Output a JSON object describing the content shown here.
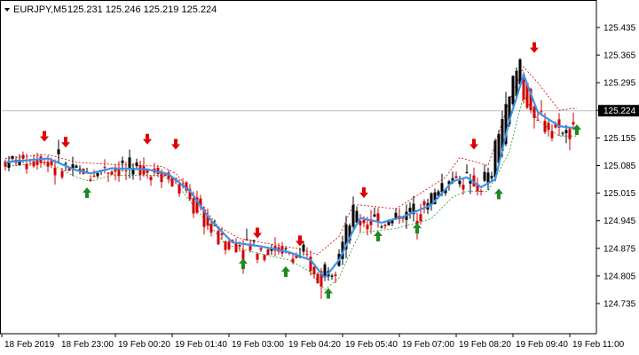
{
  "header": {
    "symbol_timeframe": "EURJPY,M5",
    "quote": "125.231 125.246 125.219 125.224"
  },
  "colors": {
    "bull_candle": "#000000",
    "bear_candle": "#d40000",
    "ma_line": "#3b93e8",
    "upper_band": "#d40000",
    "lower_band": "#1d9a1d",
    "buy_arrow": "#1d8a1d",
    "sell_arrow": "#e00000",
    "bid_line": "#c0c0c0"
  },
  "chart_data": {
    "type": "candlestick",
    "y_axis": {
      "range": [
        124.72,
        125.46
      ],
      "tick_labels": [
        "125.435",
        "125.365",
        "125.295",
        "125.225",
        "125.155",
        "125.085",
        "125.015",
        "124.945",
        "124.875",
        "124.805",
        "124.735"
      ],
      "tick_values": [
        125.435,
        125.365,
        125.295,
        125.225,
        125.155,
        125.085,
        125.015,
        124.945,
        124.875,
        124.805,
        124.735
      ]
    },
    "current_price": {
      "label": "125.224",
      "value": 125.224
    },
    "x_axis": {
      "labels": [
        "18 Feb 2019",
        "18 Feb 23:00",
        "19 Feb 00:20",
        "19 Feb 01:40",
        "19 Feb 03:00",
        "19 Feb 04:20",
        "19 Feb 05:40",
        "19 Feb 07:00",
        "19 Feb 08:20",
        "19 Feb 09:40",
        "19 Feb 11:00"
      ],
      "label_bar_index": [
        0,
        16,
        32,
        48,
        64,
        80,
        96,
        112,
        128,
        144,
        160
      ]
    },
    "bar_count": 161,
    "ma_anchors": [
      [
        0,
        125.093
      ],
      [
        12,
        125.103
      ],
      [
        20,
        125.073
      ],
      [
        24,
        125.065
      ],
      [
        30,
        125.078
      ],
      [
        40,
        125.075
      ],
      [
        46,
        125.063
      ],
      [
        52,
        125.02
      ],
      [
        58,
        124.945
      ],
      [
        64,
        124.89
      ],
      [
        72,
        124.88
      ],
      [
        80,
        124.865
      ],
      [
        86,
        124.845
      ],
      [
        90,
        124.8
      ],
      [
        94,
        124.845
      ],
      [
        98,
        124.92
      ],
      [
        100,
        124.952
      ],
      [
        106,
        124.94
      ],
      [
        112,
        124.955
      ],
      [
        120,
        124.985
      ],
      [
        126,
        125.045
      ],
      [
        130,
        125.055
      ],
      [
        134,
        125.03
      ],
      [
        138,
        125.05
      ],
      [
        142,
        125.2
      ],
      [
        146,
        125.315
      ],
      [
        150,
        125.22
      ],
      [
        156,
        125.185
      ],
      [
        160,
        125.18
      ]
    ],
    "upper_band_anchors": [
      [
        0,
        125.103
      ],
      [
        12,
        125.113
      ],
      [
        20,
        125.093
      ],
      [
        30,
        125.088
      ],
      [
        44,
        125.083
      ],
      [
        48,
        125.065
      ],
      [
        54,
        125.0
      ],
      [
        60,
        124.93
      ],
      [
        66,
        124.9
      ],
      [
        72,
        124.89
      ],
      [
        82,
        124.875
      ],
      [
        88,
        124.86
      ],
      [
        94,
        124.905
      ],
      [
        98,
        124.985
      ],
      [
        100,
        124.985
      ],
      [
        110,
        124.975
      ],
      [
        124,
        125.055
      ],
      [
        128,
        125.105
      ],
      [
        136,
        125.085
      ],
      [
        142,
        125.25
      ],
      [
        146,
        125.335
      ],
      [
        150,
        125.295
      ],
      [
        156,
        125.225
      ],
      [
        160,
        125.23
      ]
    ],
    "lower_band_anchors": [
      [
        0,
        125.083
      ],
      [
        12,
        125.093
      ],
      [
        20,
        125.055
      ],
      [
        24,
        125.045
      ],
      [
        30,
        125.06
      ],
      [
        44,
        125.06
      ],
      [
        48,
        125.04
      ],
      [
        56,
        124.95
      ],
      [
        62,
        124.885
      ],
      [
        70,
        124.865
      ],
      [
        80,
        124.845
      ],
      [
        86,
        124.815
      ],
      [
        90,
        124.77
      ],
      [
        94,
        124.8
      ],
      [
        98,
        124.88
      ],
      [
        100,
        124.915
      ],
      [
        110,
        124.925
      ],
      [
        120,
        124.95
      ],
      [
        126,
        125.005
      ],
      [
        130,
        125.02
      ],
      [
        136,
        125.02
      ],
      [
        142,
        125.12
      ],
      [
        146,
        125.265
      ],
      [
        150,
        125.2
      ],
      [
        156,
        125.16
      ],
      [
        160,
        125.16
      ]
    ],
    "sell_arrows": [
      {
        "bar": 11,
        "price": 125.15
      },
      {
        "bar": 17,
        "price": 125.135
      },
      {
        "bar": 40,
        "price": 125.143
      },
      {
        "bar": 48,
        "price": 125.13
      },
      {
        "bar": 71,
        "price": 124.905
      },
      {
        "bar": 83,
        "price": 124.885
      },
      {
        "bar": 101,
        "price": 125.007
      },
      {
        "bar": 132,
        "price": 125.13
      },
      {
        "bar": 149,
        "price": 125.375
      }
    ],
    "buy_arrows": [
      {
        "bar": 23,
        "price": 125.025
      },
      {
        "bar": 67,
        "price": 124.845
      },
      {
        "bar": 79,
        "price": 124.825
      },
      {
        "bar": 91,
        "price": 124.77
      },
      {
        "bar": 105,
        "price": 124.915
      },
      {
        "bar": 116,
        "price": 124.935
      },
      {
        "bar": 139,
        "price": 125.022
      },
      {
        "bar": 161,
        "price": 125.185
      }
    ]
  }
}
